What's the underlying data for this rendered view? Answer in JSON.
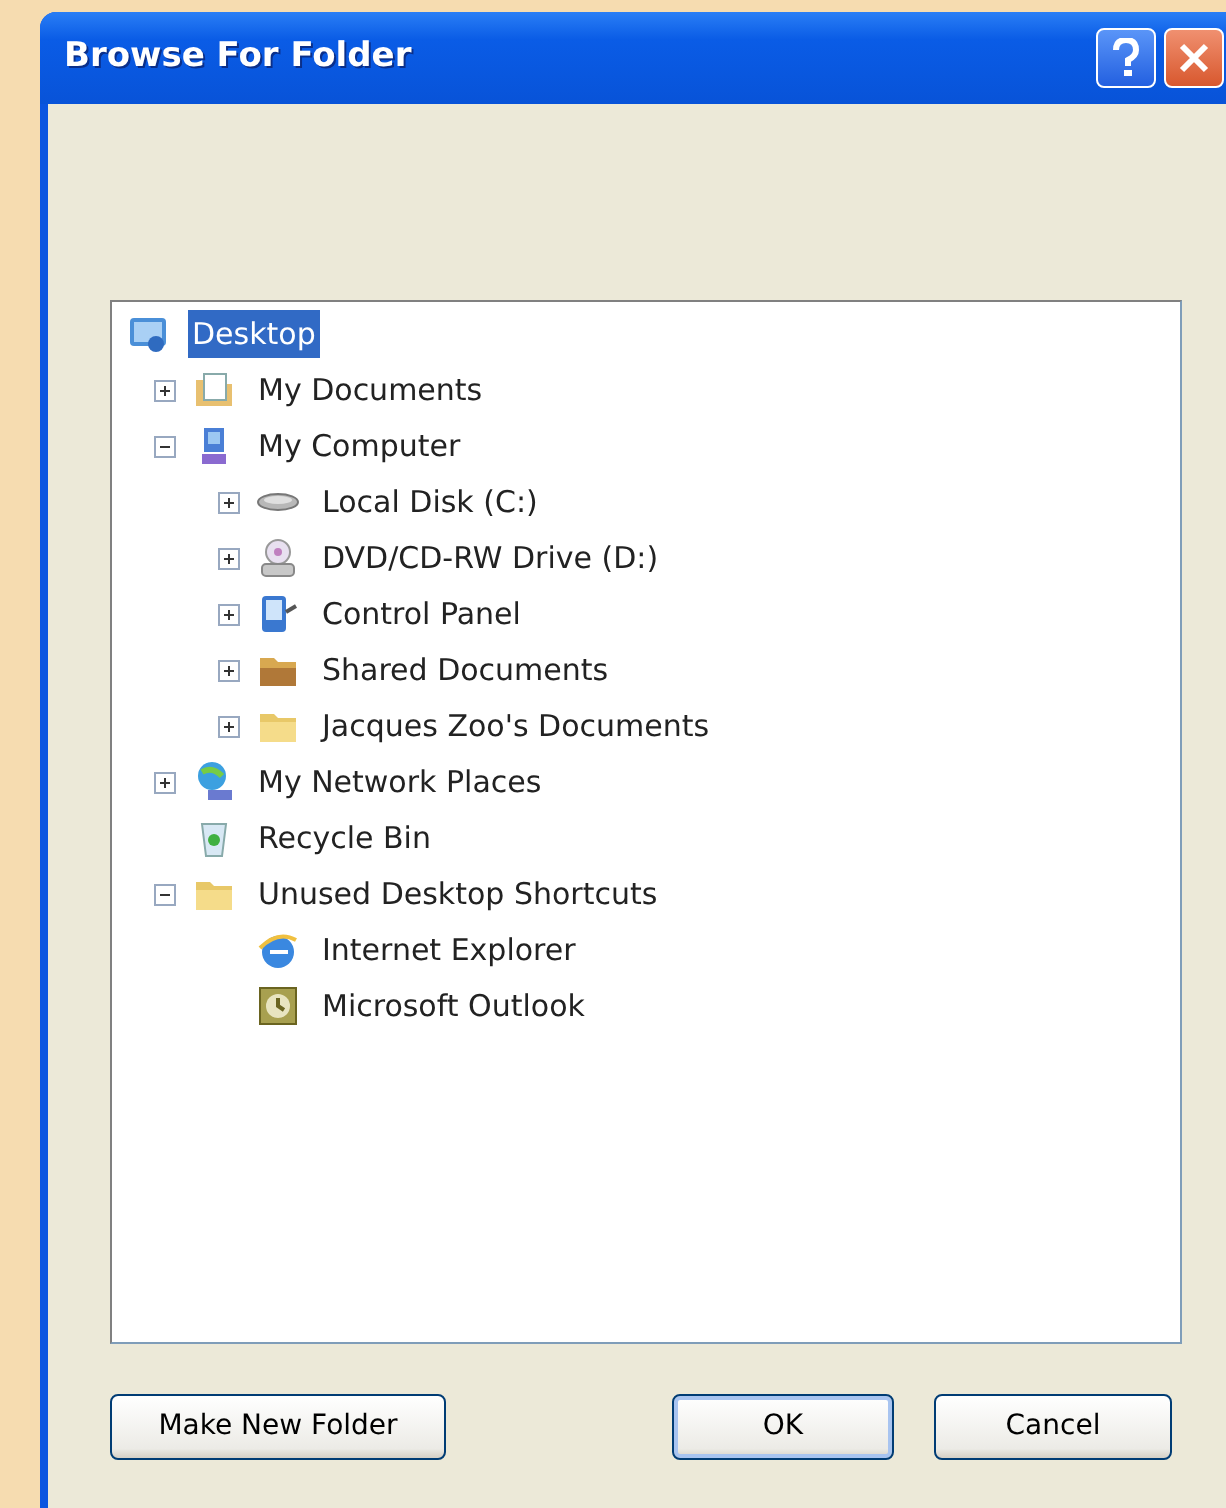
{
  "window": {
    "title": "Browse For Folder"
  },
  "tree": [
    {
      "label": "Desktop",
      "kind": "desktop",
      "selected": true,
      "children": [
        {
          "label": "My Documents",
          "kind": "documents",
          "selected": false,
          "expanded": false
        },
        {
          "label": "My Computer",
          "kind": "computer",
          "selected": false,
          "expanded": true,
          "children": [
            {
              "label": "Local Disk (C:)",
              "kind": "disk",
              "selected": false,
              "expanded": false
            },
            {
              "label": "DVD/CD-RW Drive (D:)",
              "kind": "dvd",
              "selected": false,
              "expanded": false
            },
            {
              "label": "Control Panel",
              "kind": "control-panel",
              "selected": false,
              "expanded": false
            },
            {
              "label": "Shared Documents",
              "kind": "shared-folder",
              "selected": false,
              "expanded": false
            },
            {
              "label": "Jacques Zoo's Documents",
              "kind": "folder",
              "selected": false,
              "expanded": false
            }
          ]
        },
        {
          "label": "My Network Places",
          "kind": "network",
          "selected": false,
          "expanded": false
        },
        {
          "label": "Recycle Bin",
          "kind": "recycle",
          "selected": false
        },
        {
          "label": "Unused Desktop Shortcuts",
          "kind": "folder",
          "selected": false,
          "expanded": true,
          "children": [
            {
              "label": "Internet Explorer",
              "kind": "browser",
              "selected": false
            },
            {
              "label": "Microsoft Outlook",
              "kind": "mail",
              "selected": false
            }
          ]
        }
      ]
    }
  ],
  "buttons": [
    {
      "label": "Make New Folder",
      "kind": "left"
    },
    {
      "label": "OK",
      "kind": "default"
    },
    {
      "label": "Cancel",
      "kind": "right"
    }
  ]
}
